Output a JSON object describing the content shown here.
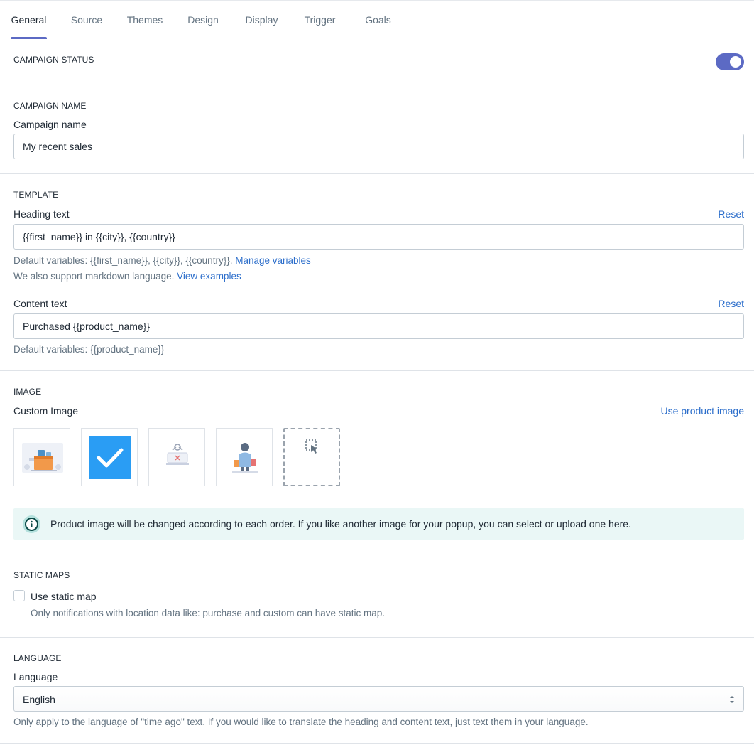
{
  "tabs": [
    {
      "label": "General",
      "active": true
    },
    {
      "label": "Source"
    },
    {
      "label": "Themes"
    },
    {
      "label": "Design"
    },
    {
      "label": "Display"
    },
    {
      "label": "Trigger"
    },
    {
      "label": "Goals"
    }
  ],
  "campaign_status": {
    "title": "CAMPAIGN STATUS",
    "enabled": true
  },
  "campaign_name": {
    "title": "CAMPAIGN NAME",
    "label": "Campaign name",
    "value": "My recent sales"
  },
  "template": {
    "title": "TEMPLATE",
    "heading_label": "Heading text",
    "heading_reset": "Reset",
    "heading_value": "{{first_name}} in {{city}}, {{country}}",
    "heading_help_prefix": "Default variables: {{first_name}}, {{city}}, {{country}}.",
    "heading_help_link": "Manage variables",
    "markdown_help_prefix": "We also support markdown language.",
    "markdown_help_link": "View examples",
    "content_label": "Content text",
    "content_reset": "Reset",
    "content_value": "Purchased {{product_name}}",
    "content_help": "Default variables: {{product_name}}"
  },
  "image": {
    "title": "IMAGE",
    "label": "Custom Image",
    "use_product_link": "Use product image",
    "thumbnails": [
      {
        "name": "store-illustration",
        "selected": false
      },
      {
        "name": "checkmark",
        "selected": true
      },
      {
        "name": "cart-illustration",
        "selected": false
      },
      {
        "name": "shopper-illustration",
        "selected": false
      },
      {
        "name": "upload",
        "selected": false
      }
    ],
    "info": "Product image will be changed according to each order. If you like another image for your popup, you can select or upload one here."
  },
  "static_maps": {
    "title": "STATIC MAPS",
    "checkbox_label": "Use static map",
    "checked": false,
    "help": "Only notifications with location data like: purchase and custom can have static map."
  },
  "language": {
    "title": "LANGUAGE",
    "label": "Language",
    "selected": "English",
    "help": "Only apply to the language of \"time ago\" text. If you would like to translate the heading and content text, just text them in your language."
  },
  "colors": {
    "accent": "#5c6ac4",
    "link": "#2c6ecb",
    "selected_thumb": "#2a9df4",
    "info_bg": "#eaf7f6"
  }
}
